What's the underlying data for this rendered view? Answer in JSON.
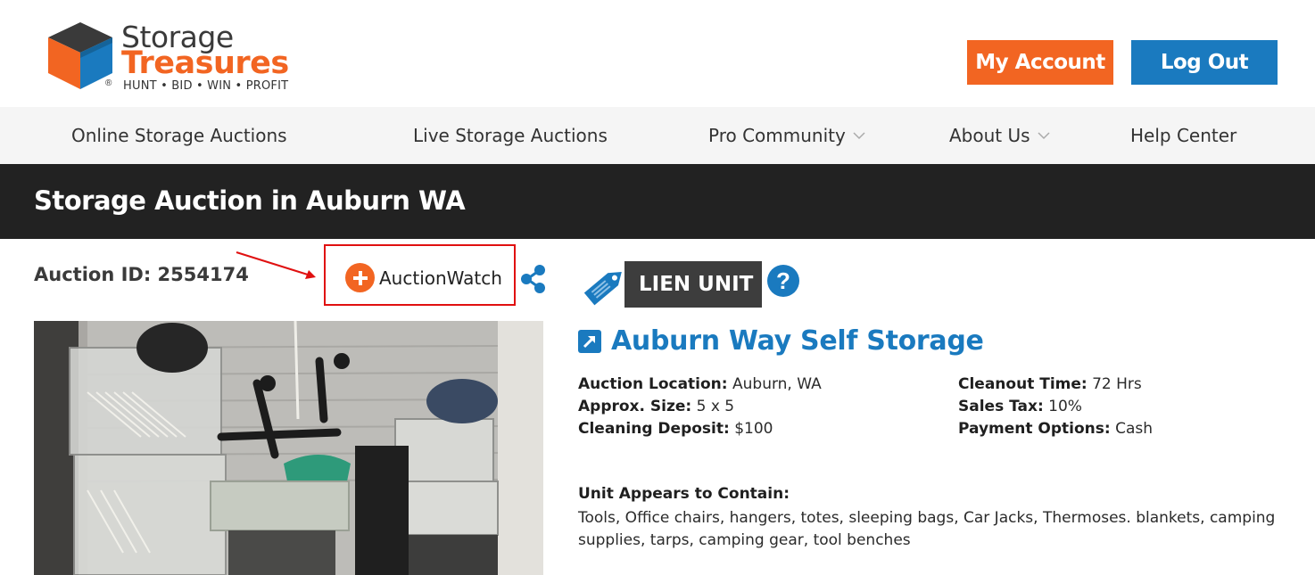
{
  "logo": {
    "word1": "Storage",
    "word2": "Treasures",
    "registered": "®",
    "tagline": "HUNT • BID • WIN • PROFIT"
  },
  "header": {
    "my_account": "My Account",
    "log_out": "Log Out"
  },
  "nav": {
    "items": [
      {
        "label": "Online Storage Auctions"
      },
      {
        "label": "Live Storage Auctions"
      },
      {
        "label": "Pro Community"
      },
      {
        "label": "About Us"
      },
      {
        "label": "Help Center"
      }
    ]
  },
  "page": {
    "title": "Storage Auction in Auburn WA"
  },
  "auction": {
    "id_label": "Auction ID: 2554174",
    "watch_label": "AuctionWatch",
    "unit_type": "LIEN UNIT",
    "help_symbol": "?",
    "facility": "Auburn Way Self Storage",
    "location_label": "Auction Location:",
    "location_value": "Auburn, WA",
    "size_label": "Approx. Size:",
    "size_value": "5 x 5",
    "deposit_label": "Cleaning Deposit:",
    "deposit_value": "$100",
    "cleanout_label": "Cleanout Time:",
    "cleanout_value": "72 Hrs",
    "tax_label": "Sales Tax:",
    "tax_value": "10%",
    "payment_label": "Payment Options:",
    "payment_value": "Cash",
    "contains_label": "Unit Appears to Contain:",
    "contains_text": "Tools, Office chairs, hangers, totes, sleeping bags, Car Jacks, Thermoses. blankets, camping supplies, tarps, camping gear, tool benches"
  },
  "colors": {
    "orange": "#f26522",
    "blue": "#1a7abf",
    "dark": "#222222",
    "nav_bg": "#f5f5f5",
    "highlight_red": "#e01010"
  },
  "icons": [
    "storage-cube-icon",
    "chevron-down-icon",
    "arrow-annotation",
    "plus-circle-icon",
    "share-icon",
    "price-tag-icon",
    "help-icon",
    "external-link-icon"
  ]
}
